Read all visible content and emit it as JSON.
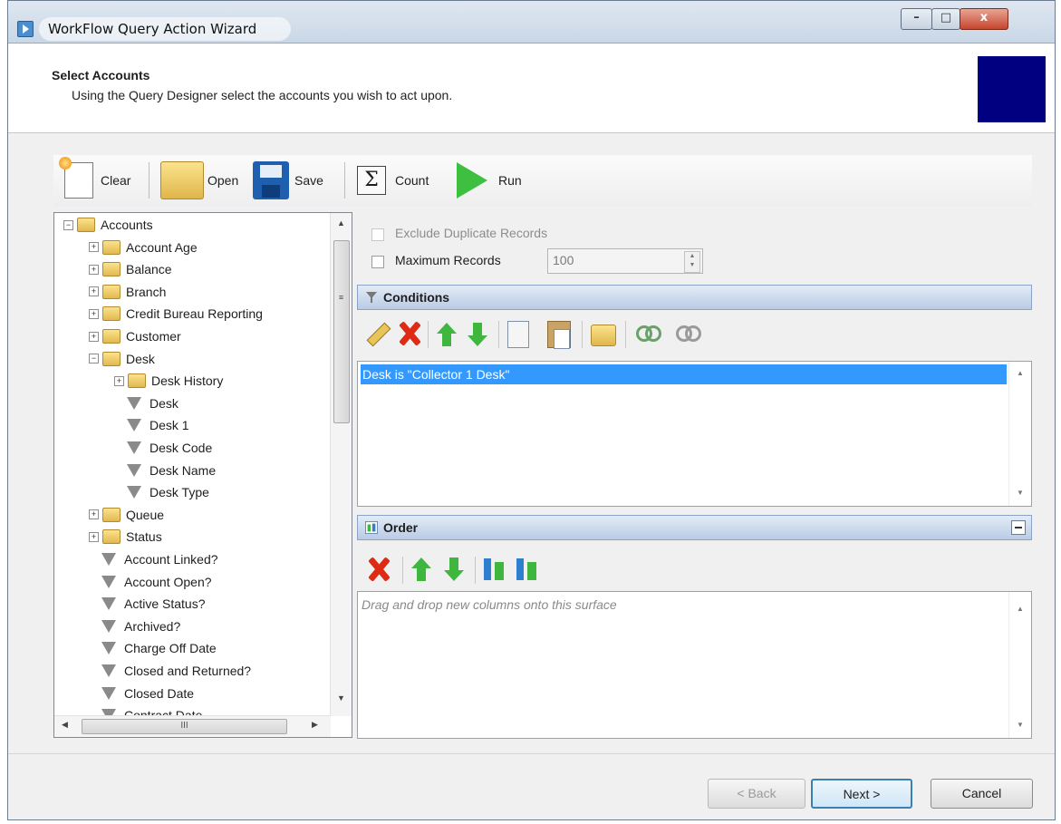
{
  "window": {
    "title": "WorkFlow Query Action Wizard",
    "controls": {
      "minimize": "–",
      "maximize": "□",
      "close": "x"
    }
  },
  "header": {
    "title": "Select Accounts",
    "subtitle": "Using the Query Designer select the accounts you wish to act upon.",
    "logo_color": "#000080"
  },
  "toolbar": {
    "clear": "Clear",
    "open": "Open",
    "save": "Save",
    "count": "Count",
    "run": "Run",
    "count_symbol": "Σ"
  },
  "tree": {
    "scroll_h_thumb": "III",
    "nodes": [
      {
        "label": "Accounts",
        "level": 0,
        "kind": "folder",
        "expander": "−"
      },
      {
        "label": "Account Age",
        "level": 1,
        "kind": "folder",
        "expander": "+"
      },
      {
        "label": "Balance",
        "level": 1,
        "kind": "folder",
        "expander": "+"
      },
      {
        "label": "Branch",
        "level": 1,
        "kind": "folder",
        "expander": "+"
      },
      {
        "label": "Credit Bureau Reporting",
        "level": 1,
        "kind": "folder",
        "expander": "+"
      },
      {
        "label": "Customer",
        "level": 1,
        "kind": "folder",
        "expander": "+"
      },
      {
        "label": "Desk",
        "level": 1,
        "kind": "folder",
        "expander": "−"
      },
      {
        "label": "Desk History",
        "level": 2,
        "kind": "folder",
        "expander": "+"
      },
      {
        "label": "Desk",
        "level": 2,
        "kind": "field"
      },
      {
        "label": "Desk 1",
        "level": 2,
        "kind": "field"
      },
      {
        "label": "Desk Code",
        "level": 2,
        "kind": "field"
      },
      {
        "label": "Desk Name",
        "level": 2,
        "kind": "field"
      },
      {
        "label": "Desk Type",
        "level": 2,
        "kind": "field"
      },
      {
        "label": "Queue",
        "level": 1,
        "kind": "folder",
        "expander": "+"
      },
      {
        "label": "Status",
        "level": 1,
        "kind": "folder",
        "expander": "+"
      },
      {
        "label": "Account Linked?",
        "level": 1,
        "kind": "field"
      },
      {
        "label": "Account Open?",
        "level": 1,
        "kind": "field"
      },
      {
        "label": "Active Status?",
        "level": 1,
        "kind": "field"
      },
      {
        "label": "Archived?",
        "level": 1,
        "kind": "field"
      },
      {
        "label": "Charge Off Date",
        "level": 1,
        "kind": "field"
      },
      {
        "label": "Closed and Returned?",
        "level": 1,
        "kind": "field"
      },
      {
        "label": "Closed Date",
        "level": 1,
        "kind": "field"
      },
      {
        "label": "Contract Date",
        "level": 1,
        "kind": "field"
      }
    ]
  },
  "options": {
    "exclude_duplicates": {
      "label": "Exclude Duplicate Records",
      "checked": false,
      "enabled": false
    },
    "max_records": {
      "label": "Maximum Records",
      "checked": false,
      "value": "100"
    }
  },
  "conditions": {
    "title": "Conditions",
    "items": [
      "Desk is \"Collector 1 Desk\""
    ]
  },
  "order": {
    "title": "Order",
    "placeholder": "Drag and drop new columns onto this surface"
  },
  "footer": {
    "back": "< Back",
    "next": "Next >",
    "cancel": "Cancel"
  }
}
